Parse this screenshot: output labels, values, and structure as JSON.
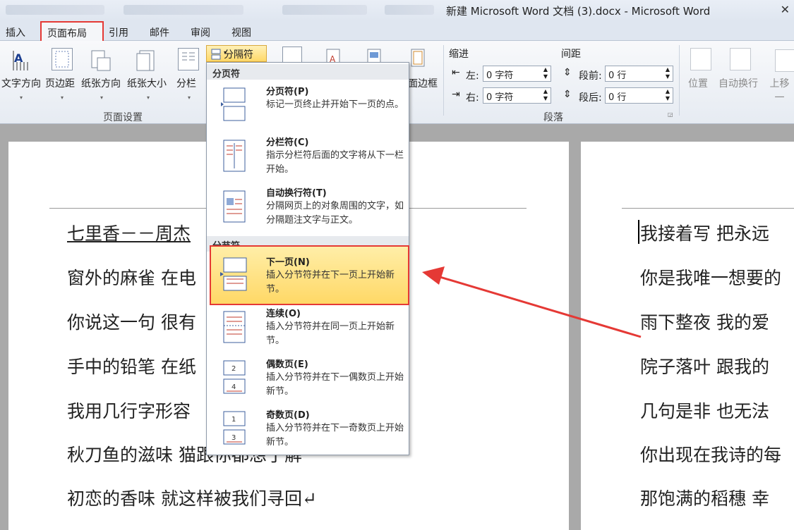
{
  "window": {
    "title": "新建 Microsoft Word 文档 (3).docx - Microsoft Word",
    "close": "✕"
  },
  "tabs": [
    "插入",
    "页面布局",
    "引用",
    "邮件",
    "审阅",
    "视图"
  ],
  "ribbon": {
    "page_setup": {
      "buttons": [
        "文字方向",
        "页边距",
        "纸张方向",
        "纸张大小",
        "分栏"
      ],
      "group_label": "页面设置"
    },
    "breaks_button": "分隔符",
    "page_border": "面边框",
    "paragraph": {
      "indent_label": "缩进",
      "spacing_label": "间距",
      "left_label": "左:",
      "right_label": "右:",
      "left_value": "0 字符",
      "right_value": "0 字符",
      "before_label": "段前:",
      "after_label": "段后:",
      "before_value": "0 行",
      "after_value": "0 行",
      "group_label": "段落"
    },
    "arrange": {
      "position": "位置",
      "wrap": "自动换行",
      "forward": "上移一"
    }
  },
  "menu": {
    "section1": "分页符",
    "section2": "分节符",
    "items": [
      {
        "title": "分页符(P)",
        "desc": "标记一页终止并开始下一页的点。"
      },
      {
        "title": "分栏符(C)",
        "desc": "指示分栏符后面的文字将从下一栏开始。"
      },
      {
        "title": "自动换行符(T)",
        "desc": "分隔网页上的对象周围的文字，如分隔题注文字与正文。"
      },
      {
        "title": "下一页(N)",
        "desc": "插入分节符并在下一页上开始新节。"
      },
      {
        "title": "连续(O)",
        "desc": "插入分节符并在同一页上开始新节。"
      },
      {
        "title": "偶数页(E)",
        "desc": "插入分节符并在下一偶数页上开始新节。"
      },
      {
        "title": "奇数页(D)",
        "desc": "插入分节符并在下一奇数页上开始新节。"
      }
    ]
  },
  "doc": {
    "left_lines": [
      "七里香－－周杰",
      "窗外的麻雀  在电",
      "你说这一句  很有",
      "手中的铅笔  在纸",
      "我用几行字形容",
      "秋刀鱼的滋味  猫跟你都想了解",
      "初恋的香味  就这样被我们寻回↵"
    ],
    "right_lines": [
      "我接着写  把永远",
      "你是我唯一想要的",
      "雨下整夜  我的爱",
      "院子落叶  跟我的",
      "几句是非  也无法",
      "你出现在我诗的每",
      "那饱满的稻穗  幸"
    ]
  },
  "colors": {
    "highlight": "#e53935",
    "menu_selected": "#ffd866"
  }
}
